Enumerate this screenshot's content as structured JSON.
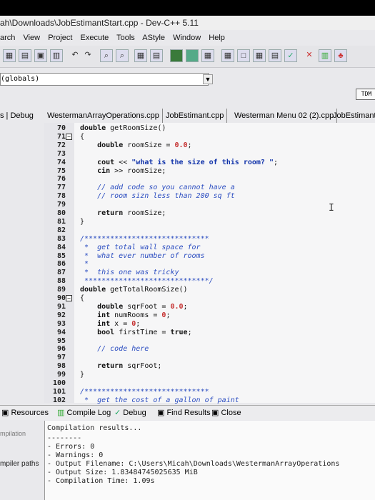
{
  "window": {
    "title": "ah\\Downloads\\JobEstimantStart.cpp - Dev-C++ 5.11"
  },
  "menu": [
    "arch",
    "View",
    "Project",
    "Execute",
    "Tools",
    "AStyle",
    "Window",
    "Help"
  ],
  "toolbar": {
    "scope_value": "(globals)",
    "tdm_label": "TDM"
  },
  "tabs": {
    "debug_tab": "s | Debug",
    "files": [
      "WestermanArrayOperations.cpp",
      "JobEstimant.cpp",
      "Westerman Menu 02 (2).cpp",
      "JobEstimantStart.c"
    ]
  },
  "editor": {
    "lines": [
      {
        "n": "70",
        "t": "double getRoomSize()"
      },
      {
        "n": "71",
        "t": "{"
      },
      {
        "n": "72",
        "t": "    double roomSize = 0.0;"
      },
      {
        "n": "73",
        "t": ""
      },
      {
        "n": "74",
        "t": "    cout << \"what is the size of this room? \";"
      },
      {
        "n": "75",
        "t": "    cin >> roomSize;"
      },
      {
        "n": "76",
        "t": ""
      },
      {
        "n": "77",
        "t": "    // add code so you cannot have a"
      },
      {
        "n": "78",
        "t": "    // room sizn less than 200 sq ft"
      },
      {
        "n": "79",
        "t": ""
      },
      {
        "n": "80",
        "t": "    return roomSize;"
      },
      {
        "n": "81",
        "t": "}"
      },
      {
        "n": "82",
        "t": ""
      },
      {
        "n": "83",
        "t": "/*****************************"
      },
      {
        "n": "84",
        "t": " *  get total wall space for"
      },
      {
        "n": "85",
        "t": " *  what ever number of rooms"
      },
      {
        "n": "86",
        "t": " *"
      },
      {
        "n": "87",
        "t": " *  this one was tricky"
      },
      {
        "n": "88",
        "t": " *****************************/"
      },
      {
        "n": "89",
        "t": "double getTotalRoomSize()"
      },
      {
        "n": "90",
        "t": "{"
      },
      {
        "n": "91",
        "t": "    double sqrFoot = 0.0;"
      },
      {
        "n": "92",
        "t": "    int numRooms = 0;"
      },
      {
        "n": "93",
        "t": "    int x = 0;"
      },
      {
        "n": "94",
        "t": "    bool firstTime = true;"
      },
      {
        "n": "95",
        "t": ""
      },
      {
        "n": "96",
        "t": "    // code here"
      },
      {
        "n": "97",
        "t": ""
      },
      {
        "n": "98",
        "t": "    return sqrFoot;"
      },
      {
        "n": "99",
        "t": "}"
      },
      {
        "n": "100",
        "t": ""
      },
      {
        "n": "101",
        "t": "/*****************************"
      },
      {
        "n": "102",
        "t": " *  get the cost of a gallon of paint"
      }
    ]
  },
  "bottom_tabs": {
    "resources": "Resources",
    "compile_log": "Compile Log",
    "debug": "Debug",
    "find_results": "Find Results",
    "close": "Close"
  },
  "log": {
    "side_compilation": "mpilation",
    "side_paths": "mpiler paths",
    "lines": [
      "Compilation results...",
      "--------",
      "- Errors: 0",
      "- Warnings: 0",
      "- Output Filename: C:\\Users\\Micah\\Downloads\\WestermanArrayOperations",
      "- Output Size: 1.83484745025635 MiB",
      "- Compilation Time: 1.09s"
    ]
  },
  "colors": {
    "keyword": "#111111",
    "string": "#1133aa",
    "number": "#c53030",
    "comment": "#2a4cc0"
  }
}
